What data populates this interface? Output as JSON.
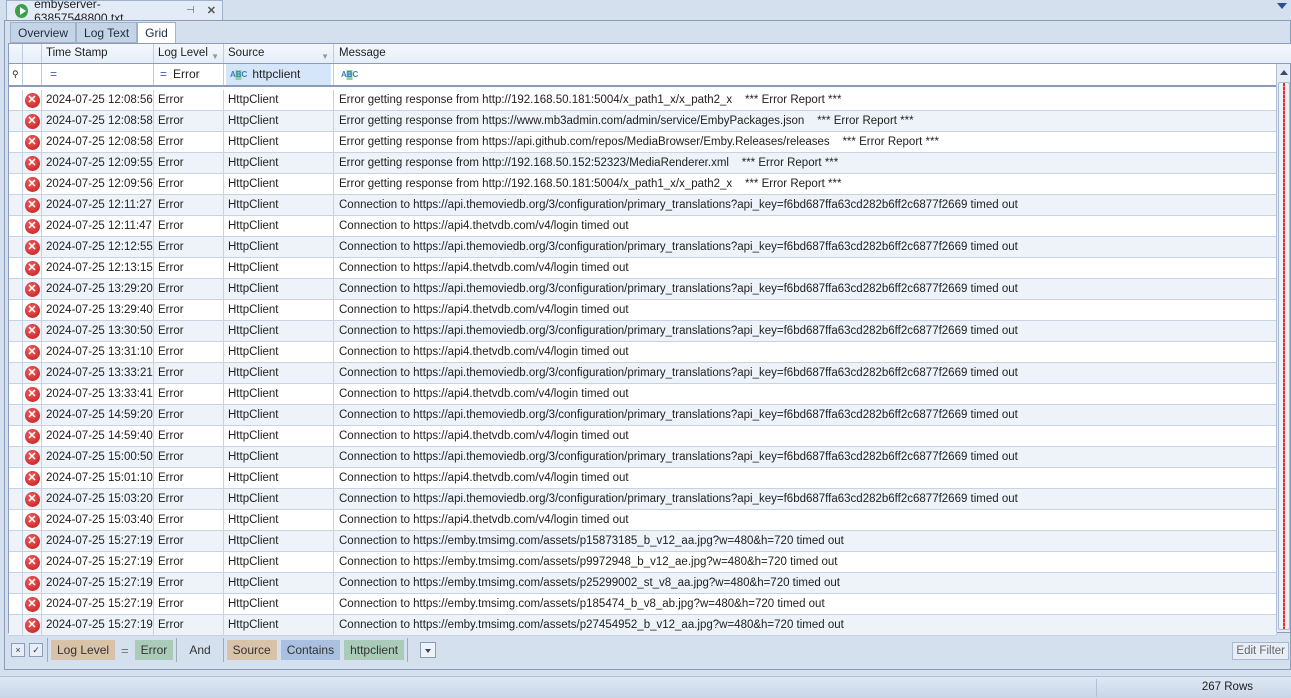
{
  "document_tab": {
    "title": "embyserver-63857548800.txt",
    "pin_icon": "pin-icon",
    "close_icon": "close-icon"
  },
  "subtabs": [
    "Overview",
    "Log Text",
    "Grid"
  ],
  "active_subtab": "Grid",
  "columns": [
    "Time Stamp",
    "Log Level",
    "Source",
    "Message"
  ],
  "filter_row": {
    "timestamp": "=",
    "level_op": "=",
    "level": "Error",
    "source": "httpclient",
    "abc": "ABC"
  },
  "rows": [
    {
      "ts": "2024-07-25 12:08:56",
      "level": "Error",
      "source": "HttpClient",
      "msg": "Error getting response from http://192.168.50.181:5004/x_path1_x/x_path2_x    *** Error Report ***"
    },
    {
      "ts": "2024-07-25 12:08:58",
      "level": "Error",
      "source": "HttpClient",
      "msg": "Error getting response from https://www.mb3admin.com/admin/service/EmbyPackages.json    *** Error Report ***"
    },
    {
      "ts": "2024-07-25 12:08:58",
      "level": "Error",
      "source": "HttpClient",
      "msg": "Error getting response from https://api.github.com/repos/MediaBrowser/Emby.Releases/releases    *** Error Report ***"
    },
    {
      "ts": "2024-07-25 12:09:55",
      "level": "Error",
      "source": "HttpClient",
      "msg": "Error getting response from http://192.168.50.152:52323/MediaRenderer.xml    *** Error Report ***"
    },
    {
      "ts": "2024-07-25 12:09:56",
      "level": "Error",
      "source": "HttpClient",
      "msg": "Error getting response from http://192.168.50.181:5004/x_path1_x/x_path2_x    *** Error Report ***"
    },
    {
      "ts": "2024-07-25 12:11:27",
      "level": "Error",
      "source": "HttpClient",
      "msg": "Connection to https://api.themoviedb.org/3/configuration/primary_translations?api_key=f6bd687ffa63cd282b6ff2c6877f2669 timed out"
    },
    {
      "ts": "2024-07-25 12:11:47",
      "level": "Error",
      "source": "HttpClient",
      "msg": "Connection to https://api4.thetvdb.com/v4/login timed out"
    },
    {
      "ts": "2024-07-25 12:12:55",
      "level": "Error",
      "source": "HttpClient",
      "msg": "Connection to https://api.themoviedb.org/3/configuration/primary_translations?api_key=f6bd687ffa63cd282b6ff2c6877f2669 timed out"
    },
    {
      "ts": "2024-07-25 12:13:15",
      "level": "Error",
      "source": "HttpClient",
      "msg": "Connection to https://api4.thetvdb.com/v4/login timed out"
    },
    {
      "ts": "2024-07-25 13:29:20",
      "level": "Error",
      "source": "HttpClient",
      "msg": "Connection to https://api.themoviedb.org/3/configuration/primary_translations?api_key=f6bd687ffa63cd282b6ff2c6877f2669 timed out"
    },
    {
      "ts": "2024-07-25 13:29:40",
      "level": "Error",
      "source": "HttpClient",
      "msg": "Connection to https://api4.thetvdb.com/v4/login timed out"
    },
    {
      "ts": "2024-07-25 13:30:50",
      "level": "Error",
      "source": "HttpClient",
      "msg": "Connection to https://api.themoviedb.org/3/configuration/primary_translations?api_key=f6bd687ffa63cd282b6ff2c6877f2669 timed out"
    },
    {
      "ts": "2024-07-25 13:31:10",
      "level": "Error",
      "source": "HttpClient",
      "msg": "Connection to https://api4.thetvdb.com/v4/login timed out"
    },
    {
      "ts": "2024-07-25 13:33:21",
      "level": "Error",
      "source": "HttpClient",
      "msg": "Connection to https://api.themoviedb.org/3/configuration/primary_translations?api_key=f6bd687ffa63cd282b6ff2c6877f2669 timed out"
    },
    {
      "ts": "2024-07-25 13:33:41",
      "level": "Error",
      "source": "HttpClient",
      "msg": "Connection to https://api4.thetvdb.com/v4/login timed out"
    },
    {
      "ts": "2024-07-25 14:59:20",
      "level": "Error",
      "source": "HttpClient",
      "msg": "Connection to https://api.themoviedb.org/3/configuration/primary_translations?api_key=f6bd687ffa63cd282b6ff2c6877f2669 timed out"
    },
    {
      "ts": "2024-07-25 14:59:40",
      "level": "Error",
      "source": "HttpClient",
      "msg": "Connection to https://api4.thetvdb.com/v4/login timed out"
    },
    {
      "ts": "2024-07-25 15:00:50",
      "level": "Error",
      "source": "HttpClient",
      "msg": "Connection to https://api.themoviedb.org/3/configuration/primary_translations?api_key=f6bd687ffa63cd282b6ff2c6877f2669 timed out"
    },
    {
      "ts": "2024-07-25 15:01:10",
      "level": "Error",
      "source": "HttpClient",
      "msg": "Connection to https://api4.thetvdb.com/v4/login timed out"
    },
    {
      "ts": "2024-07-25 15:03:20",
      "level": "Error",
      "source": "HttpClient",
      "msg": "Connection to https://api.themoviedb.org/3/configuration/primary_translations?api_key=f6bd687ffa63cd282b6ff2c6877f2669 timed out"
    },
    {
      "ts": "2024-07-25 15:03:40",
      "level": "Error",
      "source": "HttpClient",
      "msg": "Connection to https://api4.thetvdb.com/v4/login timed out"
    },
    {
      "ts": "2024-07-25 15:27:19",
      "level": "Error",
      "source": "HttpClient",
      "msg": "Connection to https://emby.tmsimg.com/assets/p15873185_b_v12_aa.jpg?w=480&h=720 timed out"
    },
    {
      "ts": "2024-07-25 15:27:19",
      "level": "Error",
      "source": "HttpClient",
      "msg": "Connection to https://emby.tmsimg.com/assets/p9972948_b_v12_ae.jpg?w=480&h=720 timed out"
    },
    {
      "ts": "2024-07-25 15:27:19",
      "level": "Error",
      "source": "HttpClient",
      "msg": "Connection to https://emby.tmsimg.com/assets/p25299002_st_v8_aa.jpg?w=480&h=720 timed out"
    },
    {
      "ts": "2024-07-25 15:27:19",
      "level": "Error",
      "source": "HttpClient",
      "msg": "Connection to https://emby.tmsimg.com/assets/p185474_b_v8_ab.jpg?w=480&h=720 timed out"
    },
    {
      "ts": "2024-07-25 15:27:19",
      "level": "Error",
      "source": "HttpClient",
      "msg": "Connection to https://emby.tmsimg.com/assets/p27454952_b_v12_aa.jpg?w=480&h=720 timed out"
    }
  ],
  "filter_bar": {
    "clear": "×",
    "field1": "Log Level",
    "op1": "=",
    "val1": "Error",
    "and": "And",
    "field2": "Source",
    "op2": "Contains",
    "val2": "httpclient",
    "edit_filter": "Edit Filter"
  },
  "status": {
    "row_count": "267 Rows"
  }
}
